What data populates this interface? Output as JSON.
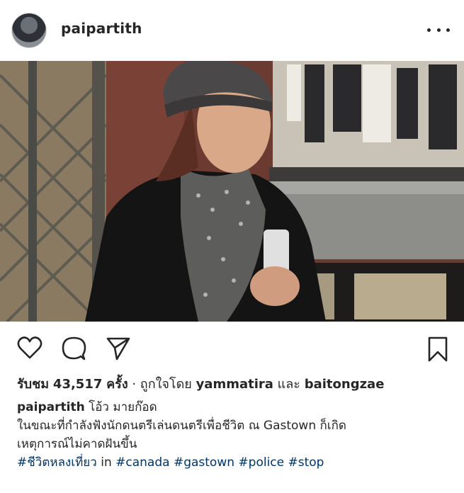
{
  "post": {
    "username": "paipartith",
    "likes": {
      "label": "รับชม",
      "count": "43,517",
      "unit": "ครั้ง",
      "liked_by_prefix": "· ถูกใจโดย",
      "liker1": "yammatira",
      "and_word": "และ",
      "liker2": "baitongzae"
    },
    "caption": {
      "username": "paipartith",
      "first_line": "โอ้ว มายก๊อด",
      "line2": "ในขณะที่กำลังฟังนักดนตรีเล่นดนตรีเพื่อชีวิต ณ Gastown ก็เกิด",
      "line3": "เหตุการณ์ไม่คาดฝันขึ้น",
      "hashtag1": "#ชีวิตหลงเที่ยว",
      "in_word": "in",
      "hashtags_rest": "#canada #gastown #police #stop"
    }
  },
  "icons": {
    "more": "more-horizontal-icon",
    "like": "heart-icon",
    "comment": "comment-bubble-icon",
    "share": "paper-plane-icon",
    "save": "bookmark-icon"
  },
  "colors": {
    "text": "#262626",
    "hashtag": "#003569"
  }
}
